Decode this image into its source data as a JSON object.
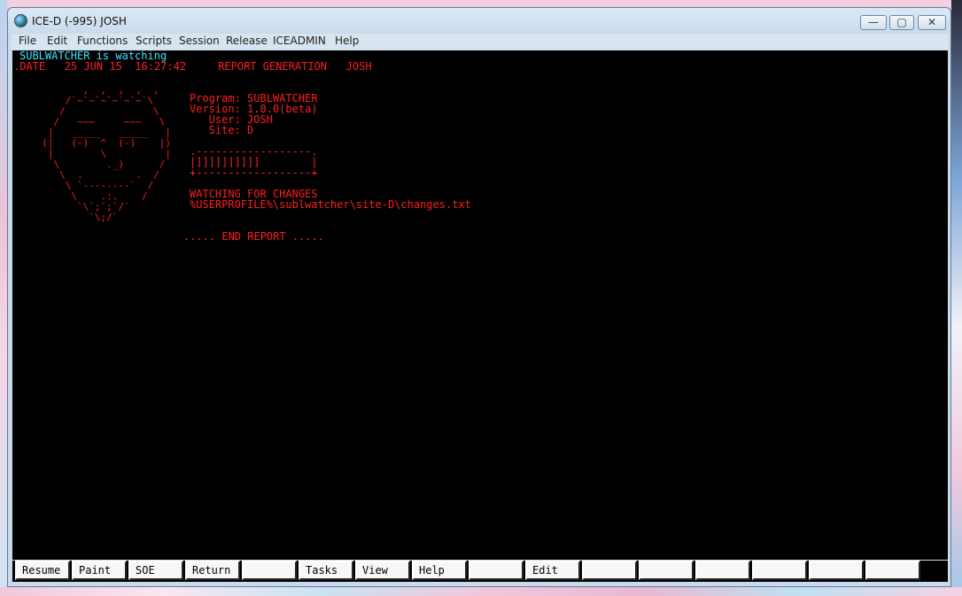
{
  "window": {
    "title": "ICE-D (-995) JOSH",
    "controls": {
      "minimize": "—",
      "maximize": "▢",
      "close": "✕"
    }
  },
  "menu": [
    "File",
    "Edit",
    "Functions",
    "Scripts",
    "Session",
    "Release",
    "ICEADMIN",
    "Help"
  ],
  "terminal": {
    "status_line": "SUBLWATCHER is watching",
    "header_line": ".DATE   25 JUN 15  16:27:42     REPORT GENERATION   JOSH",
    "ascii_face": "         ,  ,  ,  ,  ,\n      /`~`~`~`~`~`~`\\\n     /               \\\n    /   ~~~     ~~~   \\\n   |   _____   _____   |\n  (|   (-)  ^  (-)    |)\n   |        \\          |\n    \\        ._)      /\n     \\  .         .  /\n      \\ `--------`  /\n       \\    .:.    /\n        `\\`;`;`/`\n          `\\;/`",
    "program_line": "Program: SUBLWATCHER",
    "version_line": "Version: 1.0.0(beta)",
    "user_line": "   User: JOSH",
    "site_line": "   Site: D",
    "progress_top": ".------------------.",
    "progress_mid": "|]]]]]]]]]]        |",
    "progress_bottom": "+------------------+",
    "watching_line": "WATCHING FOR CHANGES",
    "path_line": "%USERPROFILE%\\sublwatcher\\site-D\\changes.txt",
    "end_line": "..... END REPORT ....."
  },
  "function_keys": [
    "Resume",
    "Paint",
    "SOE",
    "Return",
    "",
    "Tasks",
    "View",
    "Help",
    "",
    "Edit",
    "",
    "",
    "",
    "",
    "",
    ""
  ],
  "colors": {
    "terminal_bg": "#000000",
    "status_text": "#38e6ff",
    "report_text": "#ff1e1e"
  }
}
